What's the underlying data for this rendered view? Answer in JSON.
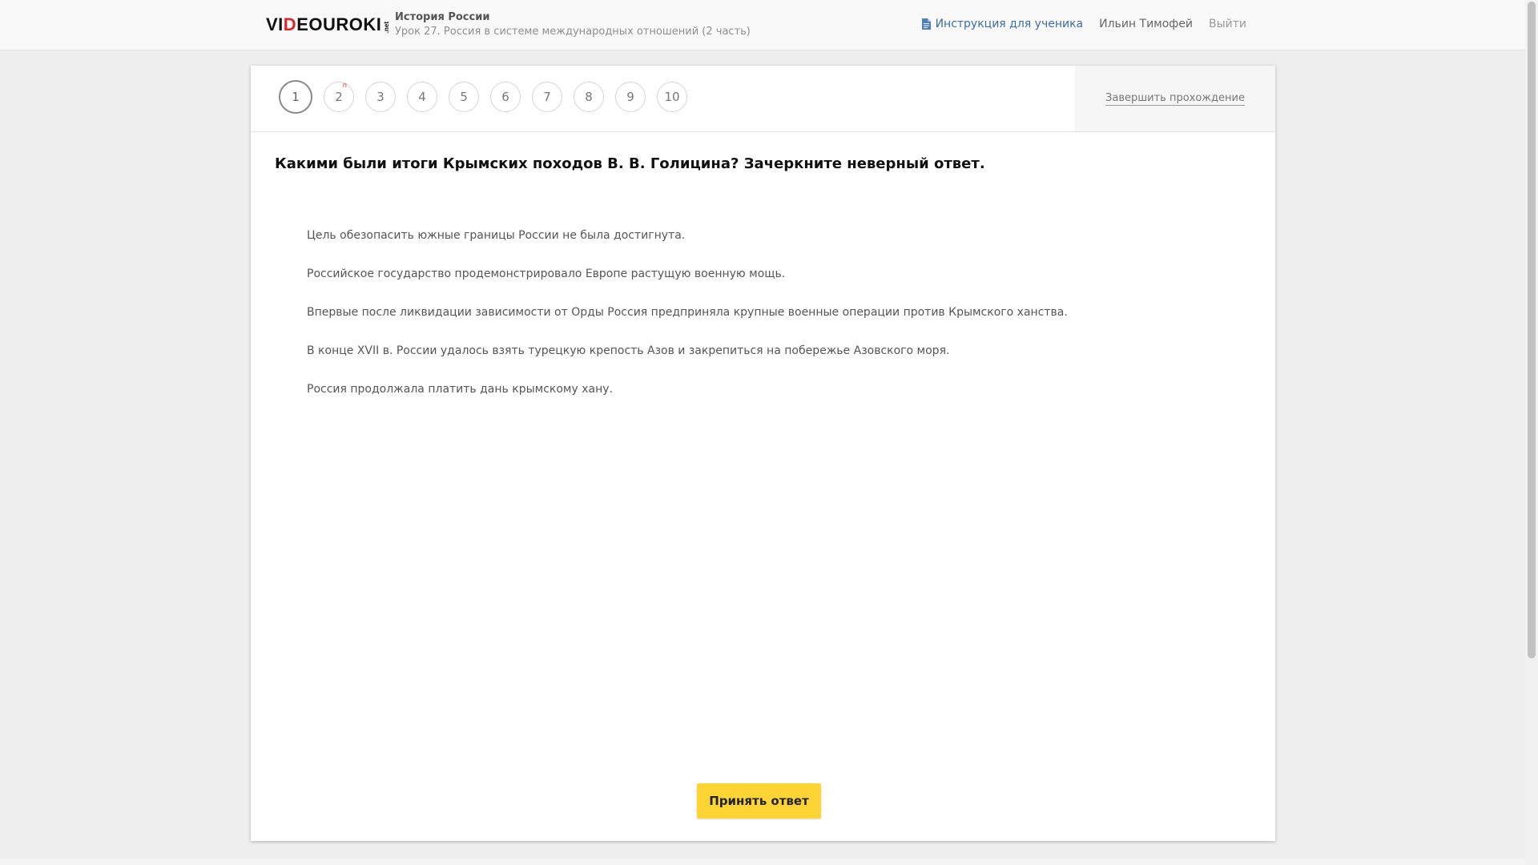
{
  "header": {
    "logo": {
      "part1": "VI",
      "part2": "D",
      "part3": "EOUROKI",
      "suffix": ".net"
    },
    "course_title": "История России",
    "lesson_title": "Урок 27. Россия в системе международных отношений (2 часть)",
    "nav": {
      "instruction_label": "Инструкция для ученика",
      "user_name": "Ильин Тимофей",
      "logout_label": "Выйти"
    }
  },
  "steps": {
    "items": [
      "1",
      "2",
      "3",
      "4",
      "5",
      "6",
      "7",
      "8",
      "9",
      "10"
    ],
    "step2_marker": "п",
    "active": "1"
  },
  "finish_label": "Завершить прохождение",
  "question": "Какими были итоги Крымских походов В. В. Голицина? Зачеркните неверный ответ.",
  "answers": [
    "Цель обезопасить южные границы России не была достигнута.",
    "Российское государство продемонстрировало Европе растущую военную мощь.",
    "Впервые после ликвидации зависимости от Орды Россия предприняла крупные военные операции против Крымского ханства.",
    "В конце XVII в. России удалось взять турецкую крепость Азов и закрепиться на побережье Азовского моря.",
    "Россия продолжала платить дань крымскому хану."
  ],
  "submit_label": "Принять ответ",
  "colors": {
    "accent_button": "#fcd535",
    "link_blue": "#3a6ea5",
    "logo_red": "#d8262d"
  },
  "icons": {
    "instruction": "document-icon"
  }
}
